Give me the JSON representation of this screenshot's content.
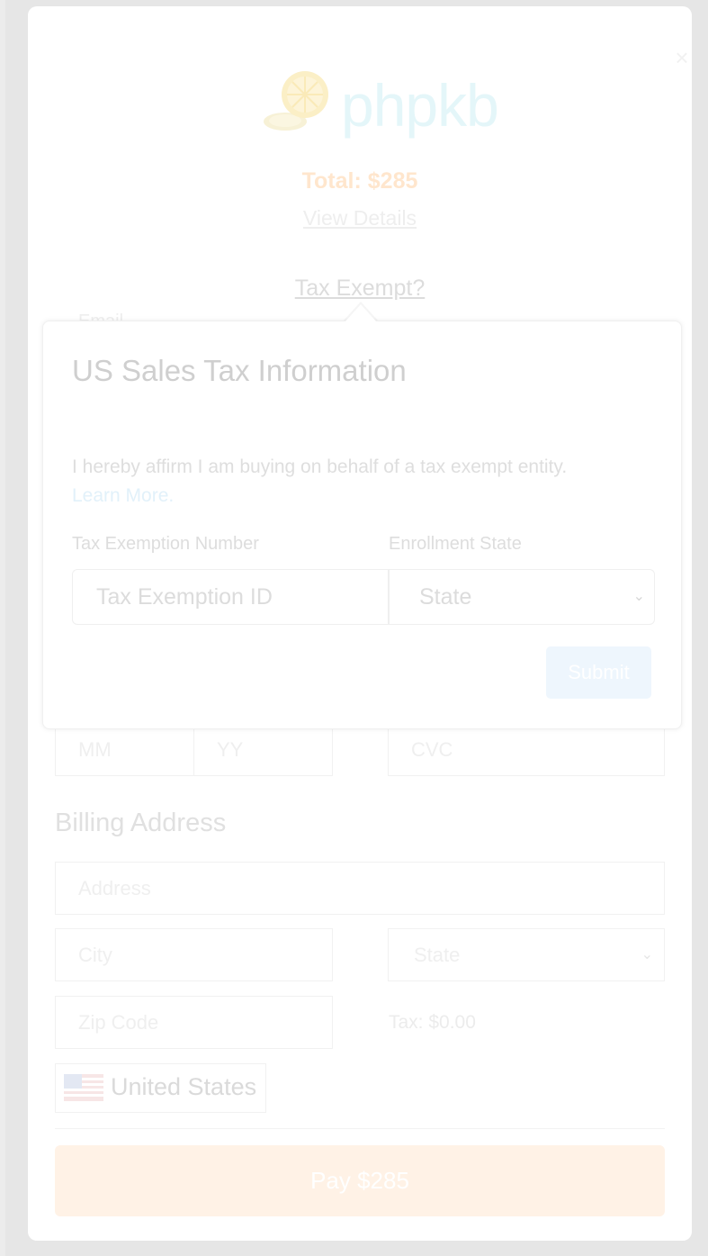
{
  "brand": {
    "name": "phpkb"
  },
  "summary": {
    "total": "Total: $285",
    "view_details": "View Details",
    "tax_exempt_link": "Tax Exempt?"
  },
  "form": {
    "email_label": "Email"
  },
  "tax_popover": {
    "title": "US Sales Tax Information",
    "affirm_text": "I hereby affirm I am buying on behalf of a tax exempt entity.",
    "learn_more": "Learn More.",
    "number_label": "Tax Exemption Number",
    "number_placeholder": "Tax Exemption ID",
    "state_label": "Enrollment State",
    "state_value": "State",
    "submit": "Submit"
  },
  "card": {
    "month_placeholder": "MM",
    "year_placeholder": "YY",
    "cvc_placeholder": "CVC"
  },
  "billing": {
    "title": "Billing Address",
    "address_placeholder": "Address",
    "city_placeholder": "City",
    "state_value": "State",
    "zip_placeholder": "Zip Code",
    "tax": "Tax: $0.00",
    "country": "United States"
  },
  "pay_button": "Pay $285",
  "colors": {
    "accent_orange": "#ffe6cd",
    "pay_button_bg": "#fff2e6",
    "submit_bg": "#eef6fd",
    "link_blue": "#e2f1fa"
  }
}
